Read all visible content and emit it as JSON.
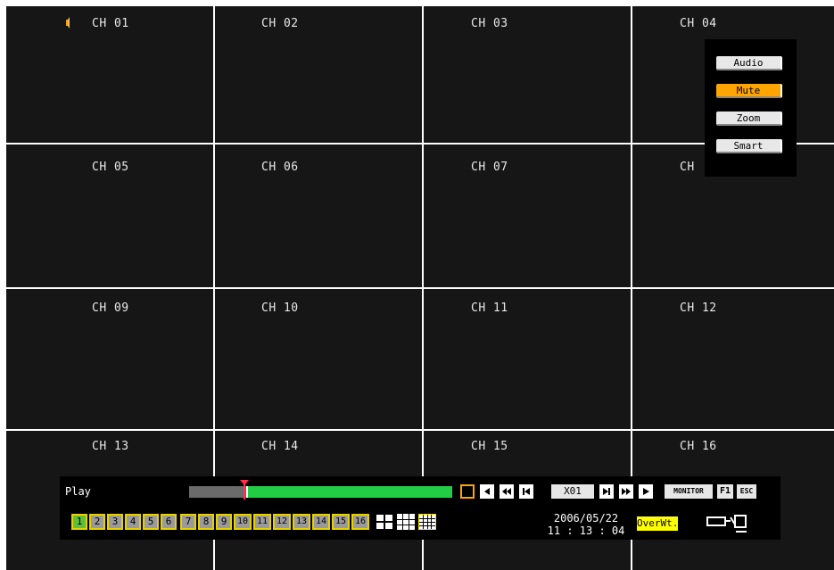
{
  "channels": [
    {
      "label": "CH 01"
    },
    {
      "label": "CH 02"
    },
    {
      "label": "CH 03"
    },
    {
      "label": "CH 04"
    },
    {
      "label": "CH 05"
    },
    {
      "label": "CH 06"
    },
    {
      "label": "CH 07"
    },
    {
      "label": "CH"
    },
    {
      "label": "CH 09"
    },
    {
      "label": "CH 10"
    },
    {
      "label": "CH 11"
    },
    {
      "label": "CH 12"
    },
    {
      "label": "CH 13"
    },
    {
      "label": "CH 14"
    },
    {
      "label": "CH 15"
    },
    {
      "label": "CH 16"
    }
  ],
  "popup": {
    "items": [
      {
        "label": "Audio"
      },
      {
        "label": "Mute",
        "active": true
      },
      {
        "label": "Zoom"
      },
      {
        "label": "Smart"
      }
    ]
  },
  "control": {
    "mode_label": "Play",
    "progress_fraction": 0.22,
    "speed": "X01",
    "monitor_label": "MONITOR",
    "f1_label": "F1",
    "esc_label": "ESC",
    "channel_buttons": [
      "1",
      "2",
      "3",
      "4",
      "5",
      "6",
      "7",
      "8",
      "9",
      "10",
      "11",
      "12",
      "13",
      "14",
      "15",
      "16"
    ],
    "selected_channel": "1",
    "date": "2006/05/22",
    "time": "11 : 13 : 04",
    "overwrite_label": "OverWt.",
    "icons": [
      "stop-icon",
      "frame-back-icon",
      "fast-rewind-icon",
      "skip-start-icon",
      "skip-end-icon",
      "fast-forward-icon",
      "play-icon",
      "split-4-icon",
      "split-9-icon",
      "split-16-icon",
      "speaker-icon",
      "dvd-icon"
    ]
  },
  "colors": {
    "accent": "#ffa400",
    "progress": "#22cc44",
    "channel_border": "#e6d200",
    "overwrite": "#ffff00"
  }
}
